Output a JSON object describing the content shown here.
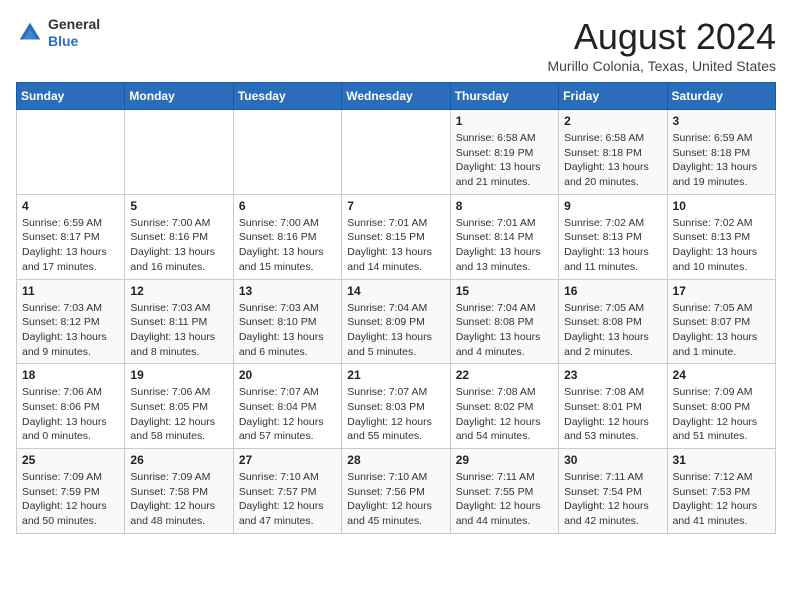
{
  "header": {
    "logo_line1": "General",
    "logo_line2": "Blue",
    "title": "August 2024",
    "subtitle": "Murillo Colonia, Texas, United States"
  },
  "days_of_week": [
    "Sunday",
    "Monday",
    "Tuesday",
    "Wednesday",
    "Thursday",
    "Friday",
    "Saturday"
  ],
  "weeks": [
    [
      {
        "day": "",
        "info": ""
      },
      {
        "day": "",
        "info": ""
      },
      {
        "day": "",
        "info": ""
      },
      {
        "day": "",
        "info": ""
      },
      {
        "day": "1",
        "info": "Sunrise: 6:58 AM\nSunset: 8:19 PM\nDaylight: 13 hours and 21 minutes."
      },
      {
        "day": "2",
        "info": "Sunrise: 6:58 AM\nSunset: 8:18 PM\nDaylight: 13 hours and 20 minutes."
      },
      {
        "day": "3",
        "info": "Sunrise: 6:59 AM\nSunset: 8:18 PM\nDaylight: 13 hours and 19 minutes."
      }
    ],
    [
      {
        "day": "4",
        "info": "Sunrise: 6:59 AM\nSunset: 8:17 PM\nDaylight: 13 hours and 17 minutes."
      },
      {
        "day": "5",
        "info": "Sunrise: 7:00 AM\nSunset: 8:16 PM\nDaylight: 13 hours and 16 minutes."
      },
      {
        "day": "6",
        "info": "Sunrise: 7:00 AM\nSunset: 8:16 PM\nDaylight: 13 hours and 15 minutes."
      },
      {
        "day": "7",
        "info": "Sunrise: 7:01 AM\nSunset: 8:15 PM\nDaylight: 13 hours and 14 minutes."
      },
      {
        "day": "8",
        "info": "Sunrise: 7:01 AM\nSunset: 8:14 PM\nDaylight: 13 hours and 13 minutes."
      },
      {
        "day": "9",
        "info": "Sunrise: 7:02 AM\nSunset: 8:13 PM\nDaylight: 13 hours and 11 minutes."
      },
      {
        "day": "10",
        "info": "Sunrise: 7:02 AM\nSunset: 8:13 PM\nDaylight: 13 hours and 10 minutes."
      }
    ],
    [
      {
        "day": "11",
        "info": "Sunrise: 7:03 AM\nSunset: 8:12 PM\nDaylight: 13 hours and 9 minutes."
      },
      {
        "day": "12",
        "info": "Sunrise: 7:03 AM\nSunset: 8:11 PM\nDaylight: 13 hours and 8 minutes."
      },
      {
        "day": "13",
        "info": "Sunrise: 7:03 AM\nSunset: 8:10 PM\nDaylight: 13 hours and 6 minutes."
      },
      {
        "day": "14",
        "info": "Sunrise: 7:04 AM\nSunset: 8:09 PM\nDaylight: 13 hours and 5 minutes."
      },
      {
        "day": "15",
        "info": "Sunrise: 7:04 AM\nSunset: 8:08 PM\nDaylight: 13 hours and 4 minutes."
      },
      {
        "day": "16",
        "info": "Sunrise: 7:05 AM\nSunset: 8:08 PM\nDaylight: 13 hours and 2 minutes."
      },
      {
        "day": "17",
        "info": "Sunrise: 7:05 AM\nSunset: 8:07 PM\nDaylight: 13 hours and 1 minute."
      }
    ],
    [
      {
        "day": "18",
        "info": "Sunrise: 7:06 AM\nSunset: 8:06 PM\nDaylight: 13 hours and 0 minutes."
      },
      {
        "day": "19",
        "info": "Sunrise: 7:06 AM\nSunset: 8:05 PM\nDaylight: 12 hours and 58 minutes."
      },
      {
        "day": "20",
        "info": "Sunrise: 7:07 AM\nSunset: 8:04 PM\nDaylight: 12 hours and 57 minutes."
      },
      {
        "day": "21",
        "info": "Sunrise: 7:07 AM\nSunset: 8:03 PM\nDaylight: 12 hours and 55 minutes."
      },
      {
        "day": "22",
        "info": "Sunrise: 7:08 AM\nSunset: 8:02 PM\nDaylight: 12 hours and 54 minutes."
      },
      {
        "day": "23",
        "info": "Sunrise: 7:08 AM\nSunset: 8:01 PM\nDaylight: 12 hours and 53 minutes."
      },
      {
        "day": "24",
        "info": "Sunrise: 7:09 AM\nSunset: 8:00 PM\nDaylight: 12 hours and 51 minutes."
      }
    ],
    [
      {
        "day": "25",
        "info": "Sunrise: 7:09 AM\nSunset: 7:59 PM\nDaylight: 12 hours and 50 minutes."
      },
      {
        "day": "26",
        "info": "Sunrise: 7:09 AM\nSunset: 7:58 PM\nDaylight: 12 hours and 48 minutes."
      },
      {
        "day": "27",
        "info": "Sunrise: 7:10 AM\nSunset: 7:57 PM\nDaylight: 12 hours and 47 minutes."
      },
      {
        "day": "28",
        "info": "Sunrise: 7:10 AM\nSunset: 7:56 PM\nDaylight: 12 hours and 45 minutes."
      },
      {
        "day": "29",
        "info": "Sunrise: 7:11 AM\nSunset: 7:55 PM\nDaylight: 12 hours and 44 minutes."
      },
      {
        "day": "30",
        "info": "Sunrise: 7:11 AM\nSunset: 7:54 PM\nDaylight: 12 hours and 42 minutes."
      },
      {
        "day": "31",
        "info": "Sunrise: 7:12 AM\nSunset: 7:53 PM\nDaylight: 12 hours and 41 minutes."
      }
    ]
  ]
}
